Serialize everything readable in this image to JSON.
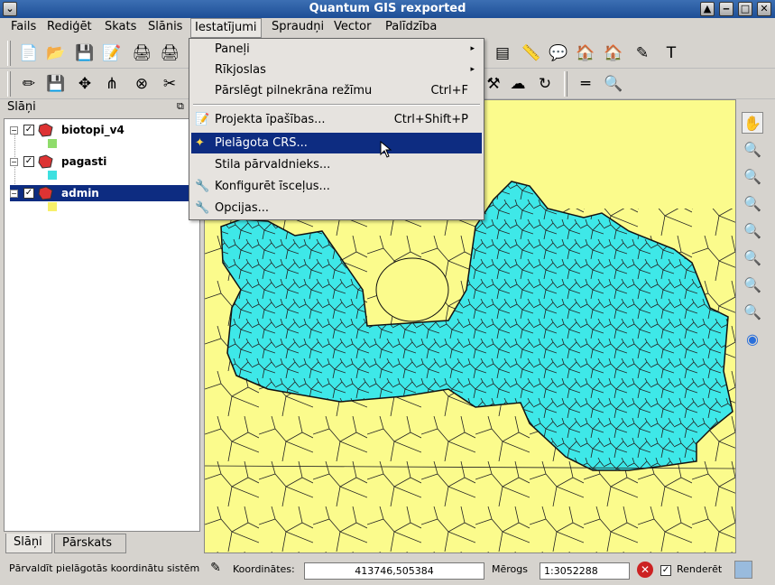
{
  "window": {
    "title": "Quantum GIS rexported"
  },
  "menubar": [
    {
      "label": "Fails"
    },
    {
      "label": "Rediģēt"
    },
    {
      "label": "Skats"
    },
    {
      "label": "Slānis"
    },
    {
      "label": "Iestatījumi"
    },
    {
      "label": "Spraudņi"
    },
    {
      "label": "Vector"
    },
    {
      "label": "Palīdzība"
    }
  ],
  "dropdown": {
    "items": [
      {
        "label": "Paneļi",
        "shortcut": "",
        "submenu": "▸"
      },
      {
        "label": "Rīkjoslas",
        "shortcut": "",
        "submenu": "▸"
      },
      {
        "label": "Pārslēgt pilnekrāna režīmu",
        "shortcut": "Ctrl+F",
        "submenu": ""
      },
      {
        "label": "Projekta īpašības...",
        "shortcut": "Ctrl+Shift+P",
        "submenu": ""
      },
      {
        "label": "Pielāgota CRS...",
        "shortcut": "",
        "submenu": ""
      },
      {
        "label": "Stila pārvaldnieks...",
        "shortcut": "",
        "submenu": ""
      },
      {
        "label": "Konfigurēt īsceļus...",
        "shortcut": "",
        "submenu": ""
      },
      {
        "label": "Opcijas...",
        "shortcut": "",
        "submenu": ""
      }
    ]
  },
  "layers_panel": {
    "title": "Slāņi",
    "layers": [
      {
        "name": "biotopi_v4",
        "checked": "✓",
        "swatch_color": "#8fdc6b"
      },
      {
        "name": "pagasti",
        "checked": "✓",
        "swatch_color": "#3ee0e0"
      },
      {
        "name": "admin",
        "checked": "✓",
        "swatch_color": "#f7f06a"
      }
    ],
    "tabs": [
      {
        "label": "Slāņi"
      },
      {
        "label": "Pārskats"
      }
    ]
  },
  "statusbar": {
    "message": "Pārvaldīt pielāgotās koordinātu sistēmas",
    "coord_label": "Koordinātes:",
    "coord_value": "413746,505384",
    "scale_label": "Mērogs",
    "scale_value": "1:3052288",
    "render_label": "Renderēt",
    "render_checked": "✓"
  },
  "colors": {
    "map_bg": "#fbfb8c",
    "fill_cyan": "#3ee8e8",
    "highlight": "#0d2c81"
  }
}
